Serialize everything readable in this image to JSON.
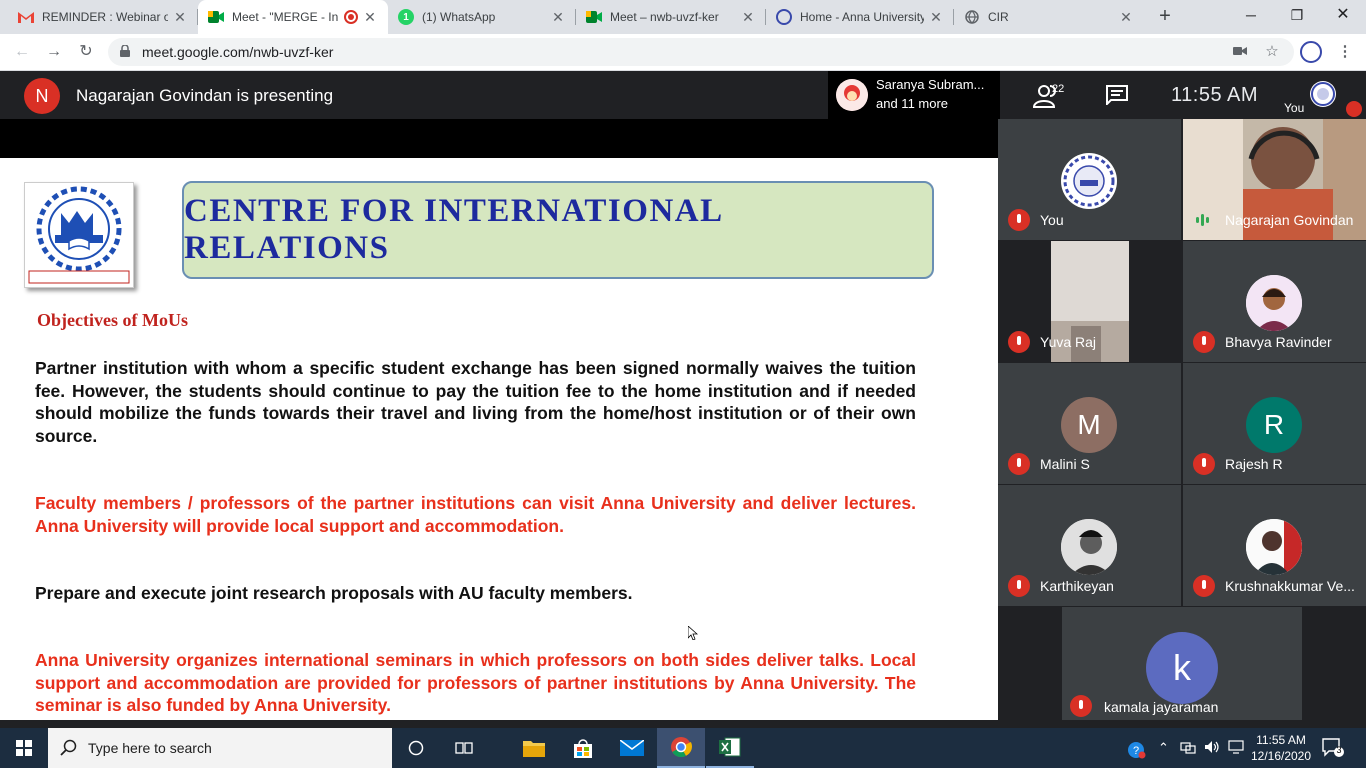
{
  "browser": {
    "tabs": [
      {
        "title": "REMINDER : Webinar o",
        "icon": "gmail-icon"
      },
      {
        "title": "Meet - \"MERGE - In",
        "icon": "meet-icon",
        "recording": true
      },
      {
        "title": "(1) WhatsApp",
        "icon": "whatsapp-icon"
      },
      {
        "title": "Meet – nwb-uvzf-ker",
        "icon": "meet-icon"
      },
      {
        "title": "Home - Anna University",
        "icon": "anna-university-icon"
      },
      {
        "title": "CIR",
        "icon": "globe-icon"
      }
    ],
    "new_tab": "+",
    "url": "meet.google.com/nwb-uvzf-ker"
  },
  "meet": {
    "presenter_initial": "N",
    "presenter_text": "Nagarajan Govindan is presenting",
    "active_speaker_line1": "Saranya Subram...",
    "active_speaker_line2": "and 11 more",
    "participant_count": "22",
    "clock": "11:55  AM",
    "you_label": "You"
  },
  "slide": {
    "banner_title": "CENTRE FOR INTERNATIONAL RELATIONS",
    "logo_text_top": "ANNA UNIVERSITY",
    "logo_text_bottom": "PROGRESS THROUGH KNOWLEDGE",
    "heading": "Objectives of MoUs",
    "paragraphs": [
      {
        "text": "Partner institution with whom a specific student exchange has been signed normally waives the tuition fee. However, the students should continue to pay the tuition fee to the home institution and if needed should mobilize the funds towards their travel and living from the home/host institution or of their own source.",
        "color": "black"
      },
      {
        "text": "Faculty members / professors of the partner institutions can visit Anna University and deliver lectures. Anna University will provide local support and accommodation.",
        "color": "red"
      },
      {
        "text": "Prepare and execute joint research proposals with AU faculty members.",
        "color": "black"
      },
      {
        "text": "Anna University organizes international seminars in which professors on both sides deliver talks. Local support and accommodation are provided for professors of partner institutions by Anna University. The seminar is also funded by Anna University.",
        "color": "red"
      }
    ]
  },
  "participants": [
    {
      "name": "You",
      "type": "logo",
      "muted": true
    },
    {
      "name": "Nagarajan Govindan",
      "type": "video",
      "muted": false,
      "speaking": true
    },
    {
      "name": "Yuva Raj",
      "type": "video",
      "muted": true
    },
    {
      "name": "Bhavya Ravinder",
      "type": "photo",
      "muted": true
    },
    {
      "name": "Malini S",
      "initial": "M",
      "color": "#8d6e63",
      "muted": true
    },
    {
      "name": "Rajesh R",
      "initial": "R",
      "color": "#00796b",
      "muted": true
    },
    {
      "name": "Karthikeyan",
      "type": "photo",
      "muted": true
    },
    {
      "name": "Krushnakkumar Ve...",
      "type": "photo",
      "muted": true
    },
    {
      "name": "kamala jayaraman",
      "initial": "k",
      "color": "#5c6bc0",
      "muted": true
    }
  ],
  "taskbar": {
    "search_placeholder": "Type here to search",
    "time": "11:55 AM",
    "date": "12/16/2020",
    "notification_count": "3"
  }
}
